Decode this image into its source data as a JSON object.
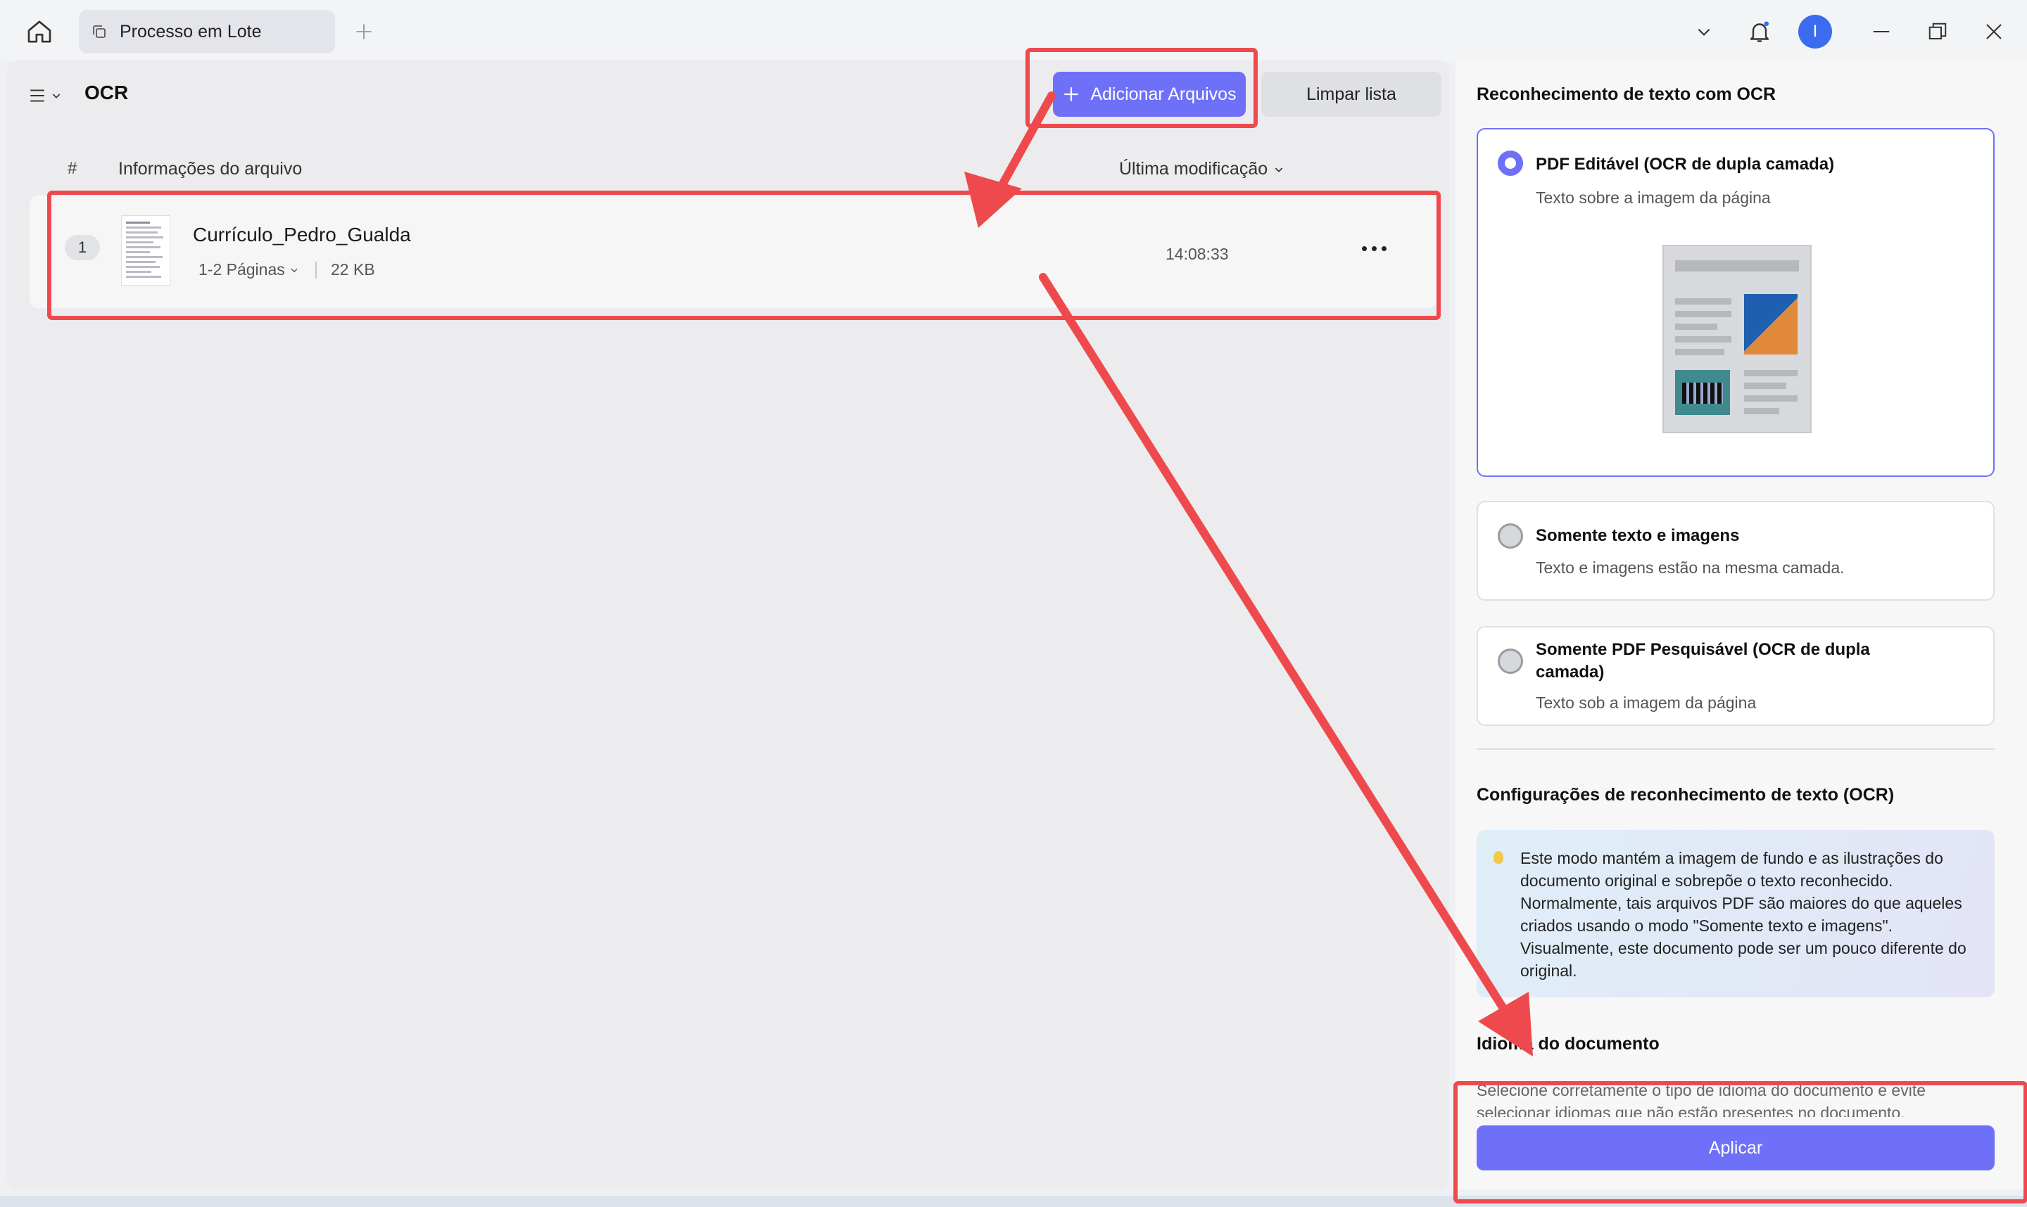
{
  "titlebar": {
    "tab_label": "Processo em Lote",
    "avatar_initial": "I"
  },
  "left": {
    "title": "OCR",
    "add_files_label": "Adicionar Arquivos",
    "clear_list_label": "Limpar lista",
    "columns": {
      "number": "#",
      "info": "Informações do arquivo",
      "modified": "Última modificação"
    },
    "files": [
      {
        "index": "1",
        "name": "Currículo_Pedro_Gualda",
        "pages": "1-2 Páginas",
        "size": "22 KB",
        "time": "14:08:33"
      }
    ]
  },
  "right": {
    "section_title": "Reconhecimento de texto com OCR",
    "options": [
      {
        "title": "PDF Editável (OCR de dupla camada)",
        "desc": "Texto sobre a imagem da página",
        "selected": true
      },
      {
        "title": "Somente texto e imagens",
        "desc": "Texto e imagens estão na mesma camada.",
        "selected": false
      },
      {
        "title": "Somente PDF Pesquisável (OCR de dupla camada)",
        "desc": "Texto sob a imagem da página",
        "selected": false
      }
    ],
    "settings_title": "Configurações de reconhecimento de texto (OCR)",
    "info_text": "Este modo mantém a imagem de fundo e as ilustrações do documento original e sobrepõe o texto reconhecido. Normalmente, tais arquivos PDF são maiores do que aqueles criados usando o modo \"Somente texto e imagens\". Visualmente, este documento pode ser um pouco diferente do original.",
    "language_title": "Idioma do documento",
    "language_desc": "Selecione corretamente o tipo de idioma do documento e evite selecionar idiomas que não estão presentes no documento.",
    "apply_label": "Aplicar"
  },
  "colors": {
    "accent": "#6f70f8",
    "annotation": "#ee4a4e",
    "avatar": "#3b6cf0"
  }
}
